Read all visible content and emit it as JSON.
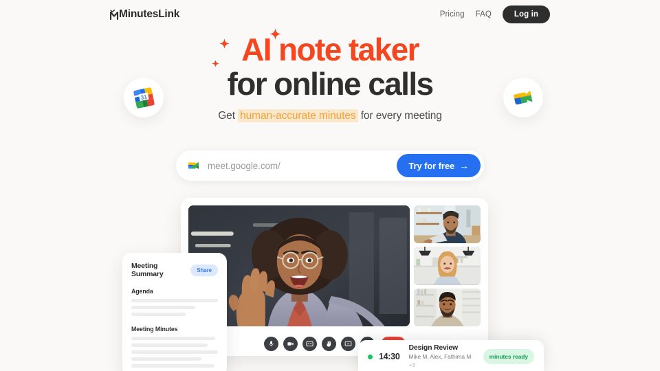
{
  "brand": {
    "name": "MinutesLink",
    "logo_icon": "minuteslink-checkmark-m-logo",
    "accent_red": "#F4461F",
    "accent_amber": "#EFA23C",
    "accent_blue": "#2470F0",
    "page_background": "#FAF9F7"
  },
  "header": {
    "nav": [
      {
        "label": "Pricing",
        "name": "nav-link-pricing"
      },
      {
        "label": "FAQ",
        "name": "nav-link-faq"
      }
    ],
    "login_label": "Log in"
  },
  "hero": {
    "headline_line1": "AI note taker",
    "headline_line2": "for online calls",
    "sub_before": "Get ",
    "sub_highlight": "human-accurate minutes",
    "sub_after": " for every meeting",
    "sparkles": [
      "sparkle-icon",
      "sparkle-icon",
      "sparkle-icon"
    ]
  },
  "bubbles": {
    "left_icon": "google-calendar-icon",
    "left_icon_day": "31",
    "right_icon": "google-meet-icon"
  },
  "url_bar": {
    "icon": "google-meet-icon",
    "placeholder": "meet.google.com/",
    "value": "",
    "cta_label": "Try for free",
    "cta_arrow": "→"
  },
  "call": {
    "main_participant": "woman-waving-video-tile",
    "thumbnails": [
      "man-in-beanie-video-tile",
      "blonde-woman-video-tile",
      "bearded-man-video-tile"
    ],
    "controls": [
      {
        "name": "mic-icon",
        "label": "Microphone"
      },
      {
        "name": "camera-icon",
        "label": "Camera"
      },
      {
        "name": "captions-icon",
        "label": "Captions"
      },
      {
        "name": "raise-hand-icon",
        "label": "Raise hand"
      },
      {
        "name": "present-screen-icon",
        "label": "Present now"
      },
      {
        "name": "more-options-icon",
        "label": "More options"
      }
    ],
    "hangup": {
      "name": "hangup-icon",
      "label": "Leave call"
    }
  },
  "summary": {
    "title": "Meeting Summary",
    "share_label": "Share",
    "section_1": "Agenda",
    "section_1_lines": [
      100,
      74,
      63
    ],
    "section_2": "Meeting Minutes",
    "section_2_lines": [
      97,
      88,
      100,
      81,
      96,
      70
    ]
  },
  "meeting": {
    "status_dot_color": "#17C264",
    "time": "14:30",
    "title": "Design Review",
    "participants": "Mike M, Alex, Fathima M",
    "participants_more": "+3",
    "badge": "minutes ready"
  }
}
